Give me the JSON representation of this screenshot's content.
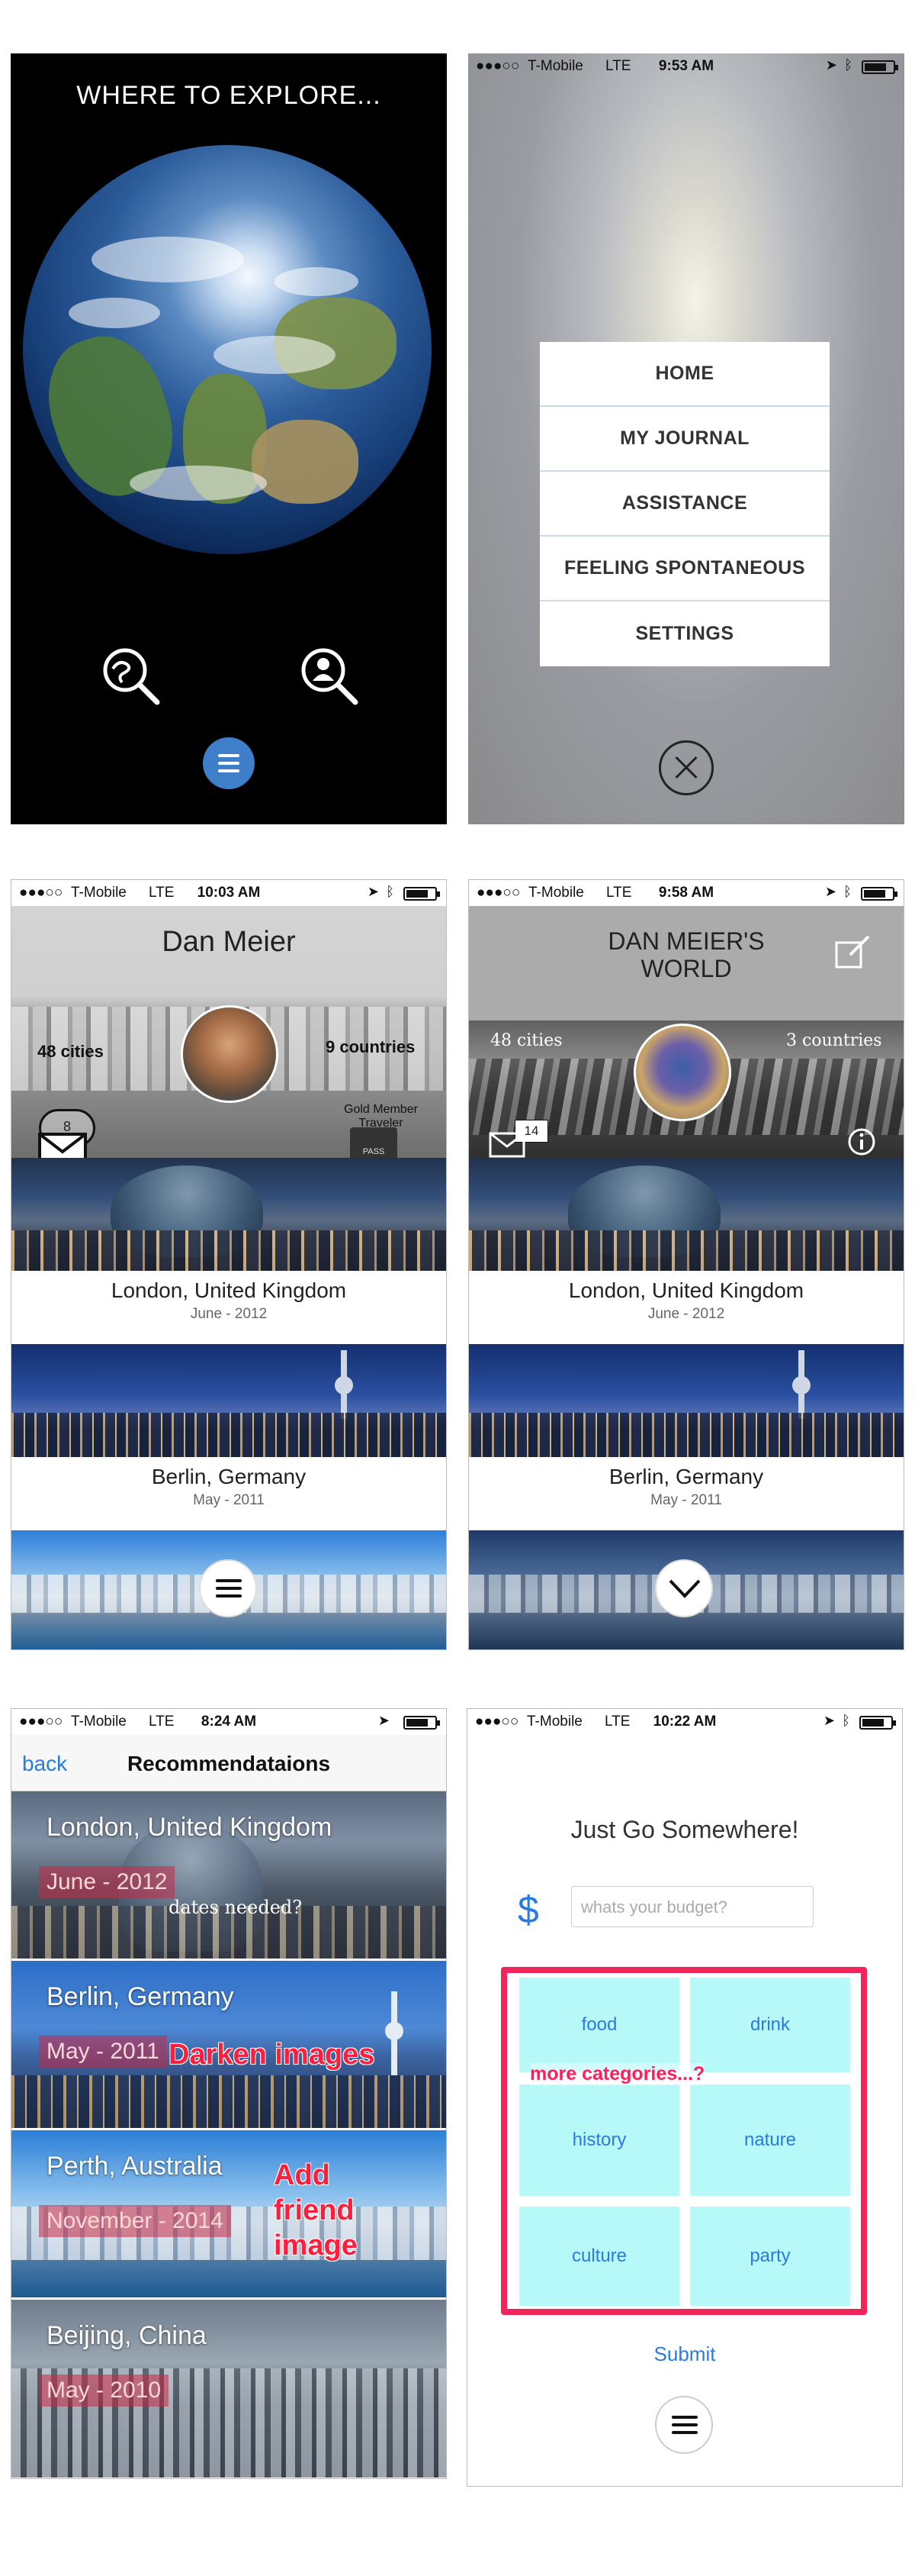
{
  "status_bars": {
    "signal": "●●●○○",
    "carrier": "T-Mobile",
    "network": "LTE",
    "times": [
      "9:53 AM",
      "10:03 AM",
      "9:58 AM",
      "8:24 AM",
      "10:22 AM"
    ]
  },
  "explore": {
    "title": "WHERE TO EXPLORE...",
    "icons": [
      "globe-search-icon",
      "person-search-icon",
      "menu-icon"
    ]
  },
  "menu": {
    "items": [
      "HOME",
      "MY JOURNAL",
      "ASSISTANCE",
      "FEELING SPONTANEOUS",
      "SETTINGS"
    ],
    "close_icon": "close-icon"
  },
  "profile_a": {
    "name": "Dan Meier",
    "cities": "48 cities",
    "countries": "9 countries",
    "messages": "8",
    "member_badge_line1": "Gold Member",
    "member_badge_line2": "Traveler",
    "passport_label": "PASS",
    "trips": [
      {
        "city": "London, United Kingdom",
        "date": "June - 2012"
      },
      {
        "city": "Berlin, Germany",
        "date": "May - 2011"
      }
    ]
  },
  "profile_b": {
    "title_line1": "DAN MEIER'S",
    "title_line2": "WORLD",
    "cities": "48 cities",
    "countries": "3 countries",
    "messages": "14",
    "trips": [
      {
        "city": "London, United Kingdom",
        "date": "June - 2012"
      },
      {
        "city": "Berlin, Germany",
        "date": "May - 2011"
      }
    ]
  },
  "recommendations": {
    "back": "back",
    "title": "Recommendataions",
    "rows": [
      {
        "city": "London, United Kingdom",
        "date": "June - 2012"
      },
      {
        "city": "Berlin, Germany",
        "date": "May - 2011"
      },
      {
        "city": "Perth, Australia",
        "date": "November - 2014"
      },
      {
        "city": "Beijing, China",
        "date": "May - 2010"
      }
    ],
    "notes": {
      "dates": "dates needed?",
      "darken": "Darken images",
      "friend_line1": "Add",
      "friend_line2": "friend",
      "friend_line3": "image"
    }
  },
  "spontaneous": {
    "title": "Just Go Somewhere!",
    "currency": "$",
    "budget_placeholder": "whats your budget?",
    "categories": [
      "food",
      "drink",
      "history",
      "nature",
      "culture",
      "party"
    ],
    "more_note": "more categories...?",
    "submit": "Submit"
  },
  "colors": {
    "accent_blue": "#2a7ae2",
    "annotation_red": "#ff1e3c",
    "category_fill": "#b7f8f8",
    "frame_pink": "#f0255c"
  }
}
